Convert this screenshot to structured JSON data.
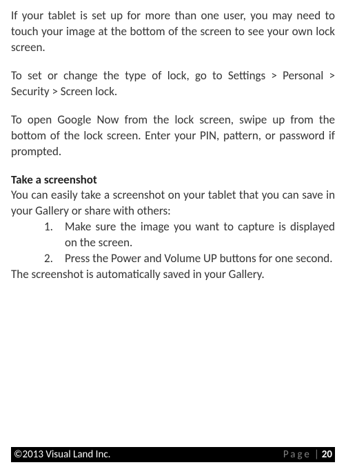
{
  "body": {
    "para1": "If your tablet is set up for more than one user, you may need to touch your image at the bottom of the screen to see your own lock screen.",
    "para2": "To set or change the type of lock, go to Settings > Personal > Security > Screen lock.",
    "para3": "To open Google Now from the lock screen, swipe up from the bottom of the lock screen. Enter your PIN, pattern, or password if prompted.",
    "heading": "Take a screenshot",
    "intro": "You can easily take a screenshot on your tablet that you can save in your Gallery or share with others:",
    "steps": [
      "Make sure the image you want to capture is displayed on the screen.",
      "Press the Power and Volume UP buttons for one second."
    ],
    "after": "The screenshot is automatically saved in your Gallery."
  },
  "footer": {
    "copyright": "©2013 Visual Land Inc.",
    "page_label": "Page",
    "page_separator": "|",
    "page_number": "20"
  }
}
